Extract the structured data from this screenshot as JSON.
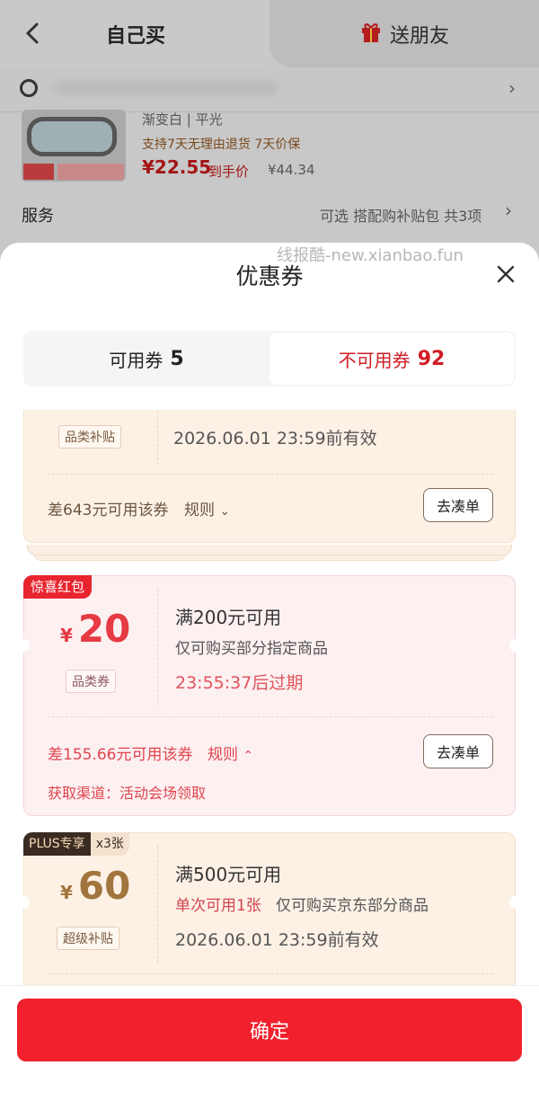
{
  "background": {
    "tab_self": "自己买",
    "tab_gift": "送朋友",
    "product_line1": "渐变白 | 平光",
    "product_line2": "支持7天无理由退货  7天价保",
    "price": "¥22.55",
    "price_suffix": "到手价",
    "orig_price": "¥44.34",
    "service_label": "服务",
    "service_value": "可选 搭配购补贴包 共3项"
  },
  "sheet": {
    "watermark": "线报酷-new.xianbao.fun",
    "title": "优惠券",
    "tabs": {
      "available_label": "可用券",
      "available_count": "5",
      "unavailable_label": "不可用券",
      "unavailable_count": "92"
    }
  },
  "coupons": [
    {
      "tag": "品类补贴",
      "validity": "2026.06.01 23:59前有效",
      "diff": "差643元可用该券",
      "rules": "规则",
      "action": "去凑单"
    },
    {
      "ribbon": "惊喜红包",
      "yen": "¥",
      "amount": "20",
      "tag": "品类券",
      "threshold": "满200元可用",
      "threshold_num": "200",
      "scope": "仅可购买部分指定商品",
      "expiry": "23:55:37后过期",
      "diff": "差155.66元可用该券",
      "rules": "规则",
      "action": "去凑单",
      "channel": "获取渠道：活动会场领取"
    },
    {
      "ribbon_plus": "PLUS专享",
      "ribbon_count": "x3张",
      "yen": "¥",
      "amount": "60",
      "tag": "超级补贴",
      "threshold": "满500元可用",
      "limit": "单次可用1张",
      "scope": "仅可购买京东部分商品",
      "validity": "2026.06.01 23:59前有效"
    }
  ],
  "confirm_label": "确定",
  "colors": {
    "accent_red": "#f0202c",
    "coupon_red": "#e63a44",
    "plus_gold": "#a2753e"
  }
}
